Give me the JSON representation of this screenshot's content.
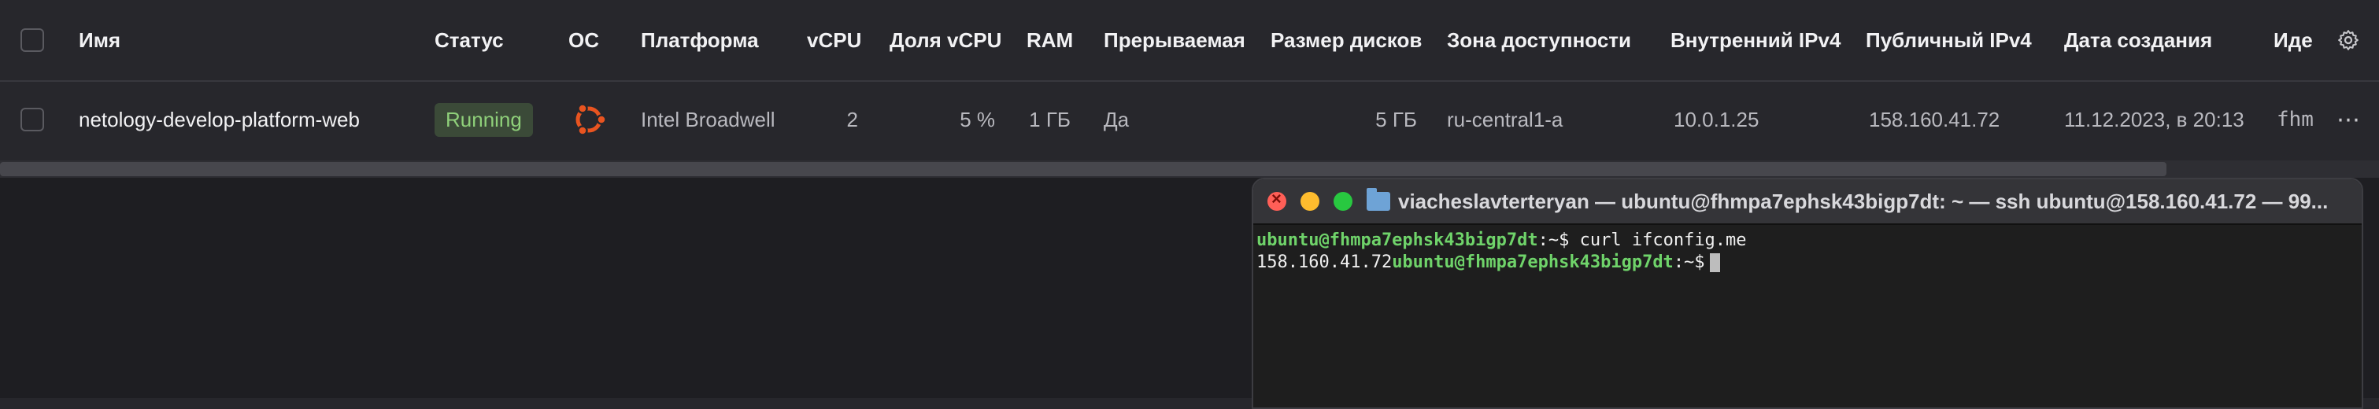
{
  "table": {
    "headers": {
      "name": "Имя",
      "status": "Статус",
      "os": "ОС",
      "platform": "Платформа",
      "vcpu": "vCPU",
      "vcpu_share": "Доля vCPU",
      "ram": "RAM",
      "preemptible": "Прерываемая",
      "disk_size": "Размер дисков",
      "zone": "Зона доступности",
      "internal_ip": "Внутренний IPv4",
      "public_ip": "Публичный IPv4",
      "created": "Дата создания",
      "id": "Иде"
    },
    "rows": [
      {
        "name": "netology-develop-platform-web",
        "status": "Running",
        "os_icon": "ubuntu-icon",
        "platform": "Intel Broadwell",
        "vcpu": "2",
        "vcpu_share": "5 %",
        "ram": "1 ГБ",
        "preemptible": "Да",
        "disk_size": "5 ГБ",
        "zone": "ru-central1-a",
        "internal_ip": "10.0.1.25",
        "public_ip": "158.160.41.72",
        "created": "11.12.2023, в 20:13",
        "id": "fhm"
      }
    ]
  },
  "terminal": {
    "title": "viacheslavterteryan — ubuntu@fhmpa7ephsk43bigp7dt: ~ — ssh ubuntu@158.160.41.72 — 99...",
    "line1_prompt": "ubuntu@fhmpa7ephsk43bigp7dt",
    "line1_path": ":~$",
    "line1_cmd": " curl ifconfig.me",
    "line2_output": "158.160.41.72",
    "line2_prompt": "ubuntu@fhmpa7ephsk43bigp7dt",
    "line2_path": ":~$"
  },
  "colors": {
    "status_running": "#8fd07a",
    "ubuntu_orange": "#e95420",
    "prompt_green": "#6fd36a"
  }
}
